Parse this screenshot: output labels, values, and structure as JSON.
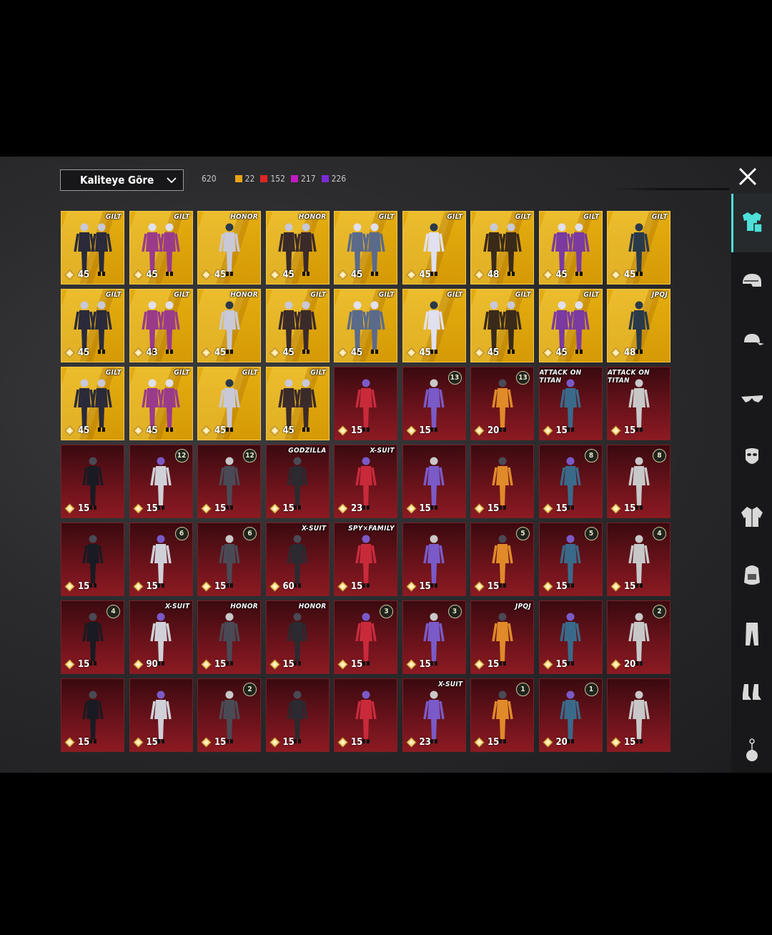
{
  "sort": {
    "label": "Kaliteye Göre"
  },
  "counts": {
    "total": "620",
    "tiers": [
      {
        "value": "22",
        "color": "#e8a317"
      },
      {
        "value": "152",
        "color": "#e02424"
      },
      {
        "value": "217",
        "color": "#c21bc2"
      },
      {
        "value": "226",
        "color": "#7a2bd6"
      }
    ]
  },
  "colors": {
    "accent": "#4ee0d8",
    "gold": "#e4ad10",
    "red": "#6a121a"
  },
  "sidebar": {
    "tabs": [
      "outfit-icon",
      "helmet-icon",
      "cap-icon",
      "glasses-icon",
      "mask-icon",
      "jacket-icon",
      "backpack-icon",
      "pants-icon",
      "shoes-icon",
      "pendant-icon"
    ],
    "active": 0
  },
  "items": [
    {
      "tier": "gold",
      "logo": "GILT",
      "price": "45"
    },
    {
      "tier": "gold",
      "logo": "GILT",
      "price": "45"
    },
    {
      "tier": "gold",
      "logo": "HONOR",
      "price": "45"
    },
    {
      "tier": "gold",
      "logo": "HONOR",
      "price": "45"
    },
    {
      "tier": "gold",
      "logo": "GILT",
      "price": "45"
    },
    {
      "tier": "gold",
      "logo": "GILT",
      "price": "45"
    },
    {
      "tier": "gold",
      "logo": "GILT",
      "price": "48"
    },
    {
      "tier": "gold",
      "logo": "GILT",
      "price": "45"
    },
    {
      "tier": "gold",
      "logo": "GILT",
      "price": "45"
    },
    {
      "tier": "gold",
      "logo": "GILT",
      "price": "45"
    },
    {
      "tier": "gold",
      "logo": "GILT",
      "price": "43"
    },
    {
      "tier": "gold",
      "logo": "HONOR",
      "price": "45"
    },
    {
      "tier": "gold",
      "logo": "GILT",
      "price": "45"
    },
    {
      "tier": "gold",
      "logo": "GILT",
      "price": "45"
    },
    {
      "tier": "gold",
      "logo": "GILT",
      "price": "45"
    },
    {
      "tier": "gold",
      "logo": "GILT",
      "price": "45"
    },
    {
      "tier": "gold",
      "logo": "GILT",
      "price": "45"
    },
    {
      "tier": "gold",
      "logo": "JPQJ",
      "price": "48"
    },
    {
      "tier": "gold",
      "logo": "GILT",
      "price": "45"
    },
    {
      "tier": "gold",
      "logo": "GILT",
      "price": "45"
    },
    {
      "tier": "gold",
      "logo": "GILT",
      "price": "45"
    },
    {
      "tier": "gold",
      "logo": "GILT",
      "price": "45"
    },
    {
      "tier": "red",
      "price": "15"
    },
    {
      "tier": "red",
      "badge": "13",
      "price": "15"
    },
    {
      "tier": "red",
      "badge": "13",
      "price": "20"
    },
    {
      "tier": "red",
      "logo": "ATTACK ON TITAN",
      "price": "15"
    },
    {
      "tier": "red",
      "logo": "ATTACK ON TITAN",
      "price": "15"
    },
    {
      "tier": "red",
      "price": "15"
    },
    {
      "tier": "red",
      "badge": "12",
      "price": "15"
    },
    {
      "tier": "red",
      "badge": "12",
      "price": "15"
    },
    {
      "tier": "red",
      "logo": "GODZILLA",
      "price": "15"
    },
    {
      "tier": "red",
      "logo": "X-SUIT",
      "price": "23"
    },
    {
      "tier": "red",
      "price": "15"
    },
    {
      "tier": "red",
      "price": "15"
    },
    {
      "tier": "red",
      "badge": "8",
      "price": "15"
    },
    {
      "tier": "red",
      "badge": "8",
      "price": "15"
    },
    {
      "tier": "red",
      "price": "15"
    },
    {
      "tier": "red",
      "badge": "6",
      "price": "15"
    },
    {
      "tier": "red",
      "badge": "6",
      "price": "15"
    },
    {
      "tier": "red",
      "logo": "X-SUIT",
      "price": "60"
    },
    {
      "tier": "red",
      "logo": "SPY×FAMILY",
      "price": "15"
    },
    {
      "tier": "red",
      "price": "15"
    },
    {
      "tier": "red",
      "badge": "5",
      "price": "15"
    },
    {
      "tier": "red",
      "badge": "5",
      "price": "15"
    },
    {
      "tier": "red",
      "badge": "4",
      "price": "15"
    },
    {
      "tier": "red",
      "badge": "4",
      "price": "15"
    },
    {
      "tier": "red",
      "logo": "X-SUIT",
      "price": "90"
    },
    {
      "tier": "red",
      "logo": "HONOR",
      "price": "15"
    },
    {
      "tier": "red",
      "logo": "HONOR",
      "price": "15"
    },
    {
      "tier": "red",
      "badge": "3",
      "price": "15"
    },
    {
      "tier": "red",
      "badge": "3",
      "price": "15"
    },
    {
      "tier": "red",
      "logo": "JPQJ",
      "price": "15"
    },
    {
      "tier": "red",
      "price": "15"
    },
    {
      "tier": "red",
      "badge": "2",
      "price": "20"
    },
    {
      "tier": "red",
      "price": "15"
    },
    {
      "tier": "red",
      "price": "15"
    },
    {
      "tier": "red",
      "badge": "2",
      "price": "15"
    },
    {
      "tier": "red",
      "price": "15"
    },
    {
      "tier": "red",
      "price": "15"
    },
    {
      "tier": "red",
      "logo": "X-SUIT",
      "price": "23"
    },
    {
      "tier": "red",
      "badge": "1",
      "price": "15"
    },
    {
      "tier": "red",
      "badge": "1",
      "price": "20"
    },
    {
      "tier": "red",
      "price": "15"
    }
  ]
}
